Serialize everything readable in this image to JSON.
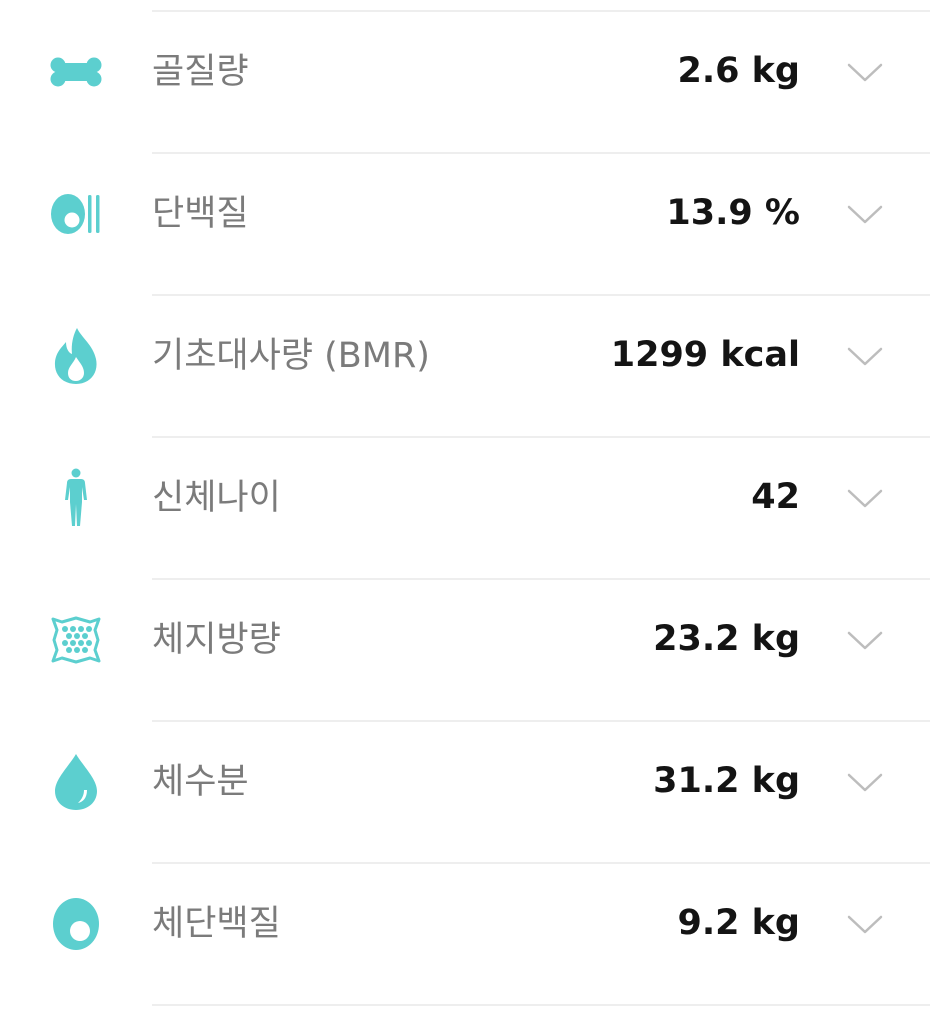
{
  "accent_color": "#5ccfcf",
  "metrics": [
    {
      "label": "골질량",
      "value": "2.6 kg",
      "icon": "bone-icon"
    },
    {
      "label": "단백질",
      "value": "13.9 %",
      "icon": "protein-icon"
    },
    {
      "label": "기초대사량 (BMR)",
      "value": "1299 kcal",
      "icon": "flame-icon"
    },
    {
      "label": "신체나이",
      "value": "42",
      "icon": "body-figure-icon"
    },
    {
      "label": "체지방량",
      "value": "23.2 kg",
      "icon": "fat-cells-icon"
    },
    {
      "label": "체수분",
      "value": "31.2 kg",
      "icon": "water-drop-icon"
    },
    {
      "label": "체단백질",
      "value": "9.2 kg",
      "icon": "body-protein-icon"
    }
  ]
}
